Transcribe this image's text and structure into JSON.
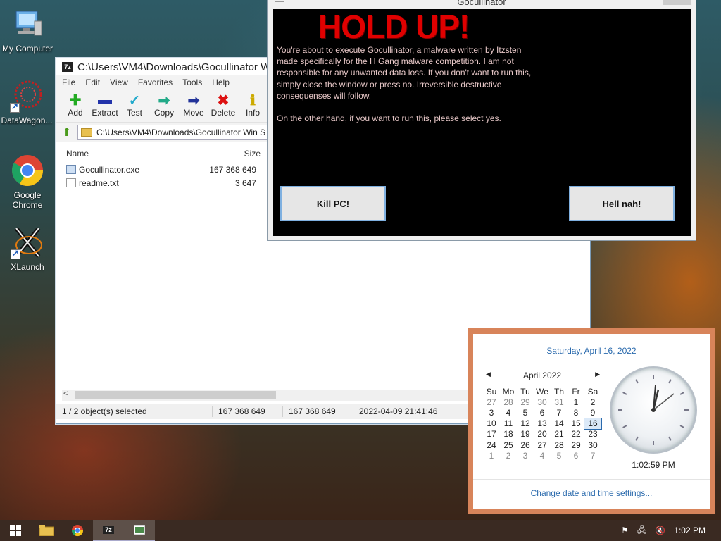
{
  "desktop": {
    "icons": [
      {
        "label": "My Computer",
        "icon": "computer-icon"
      },
      {
        "label": "DataWagon...",
        "icon": "datawagon-icon"
      },
      {
        "label": "Google Chrome",
        "icon": "chrome-icon"
      },
      {
        "label": "XLaunch",
        "icon": "xlaunch-icon"
      }
    ]
  },
  "zip": {
    "title": "C:\\Users\\VM4\\Downloads\\Gocullinator W",
    "menu": [
      "File",
      "Edit",
      "View",
      "Favorites",
      "Tools",
      "Help"
    ],
    "toolbar": [
      {
        "label": "Add",
        "icon": "add-icon",
        "color": "#22aa22"
      },
      {
        "label": "Extract",
        "icon": "extract-icon",
        "color": "#2233aa"
      },
      {
        "label": "Test",
        "icon": "test-icon",
        "color": "#22aacc"
      },
      {
        "label": "Copy",
        "icon": "copy-icon",
        "color": "#22aa88"
      },
      {
        "label": "Move",
        "icon": "move-icon",
        "color": "#223399"
      },
      {
        "label": "Delete",
        "icon": "delete-icon",
        "color": "#dd1111"
      },
      {
        "label": "Info",
        "icon": "info-icon",
        "color": "#ccaa00"
      }
    ],
    "address": "C:\\Users\\VM4\\Downloads\\Gocullinator Win S",
    "columns": {
      "name": "Name",
      "size": "Size"
    },
    "files": [
      {
        "name": "Gocullinator.exe",
        "size": "167 368 649",
        "type": "exe"
      },
      {
        "name": "readme.txt",
        "size": "3 647",
        "type": "txt"
      }
    ],
    "status": {
      "selected": "1 / 2 object(s) selected",
      "size1": "167 368 649",
      "size2": "167 368 649",
      "modified": "2022-04-09 21:41:46"
    }
  },
  "goc": {
    "title": "Gocullinator",
    "headline": "HOLD UP!",
    "paragraph1": "You're about to execute Gocullinator, a malware written by Itzsten made specifically for the H Gang malware competition. I am not responsible for any unwanted data loss. If you don't want to run this, simply close the window or press no. Irreversible destructive consequenses will follow.",
    "paragraph2": "On the other hand, if you want to run this, please select yes.",
    "kill_label": "Kill PC!",
    "nah_label": "Hell nah!"
  },
  "calendar": {
    "date_header": "Saturday, April 16, 2022",
    "month_label": "April 2022",
    "weekdays": [
      "Su",
      "Mo",
      "Tu",
      "We",
      "Th",
      "Fr",
      "Sa"
    ],
    "weeks": [
      [
        "27",
        "28",
        "29",
        "30",
        "31",
        "1",
        "2"
      ],
      [
        "3",
        "4",
        "5",
        "6",
        "7",
        "8",
        "9"
      ],
      [
        "10",
        "11",
        "12",
        "13",
        "14",
        "15",
        "16"
      ],
      [
        "17",
        "18",
        "19",
        "20",
        "21",
        "22",
        "23"
      ],
      [
        "24",
        "25",
        "26",
        "27",
        "28",
        "29",
        "30"
      ],
      [
        "1",
        "2",
        "3",
        "4",
        "5",
        "6",
        "7"
      ]
    ],
    "today": "16",
    "clock_time": "1:02:59 PM",
    "settings_link": "Change date and time settings..."
  },
  "taskbar": {
    "clock": "1:02 PM",
    "colors": {
      "taskbar": "#3a2a22",
      "accent": "#2a6aad"
    }
  }
}
